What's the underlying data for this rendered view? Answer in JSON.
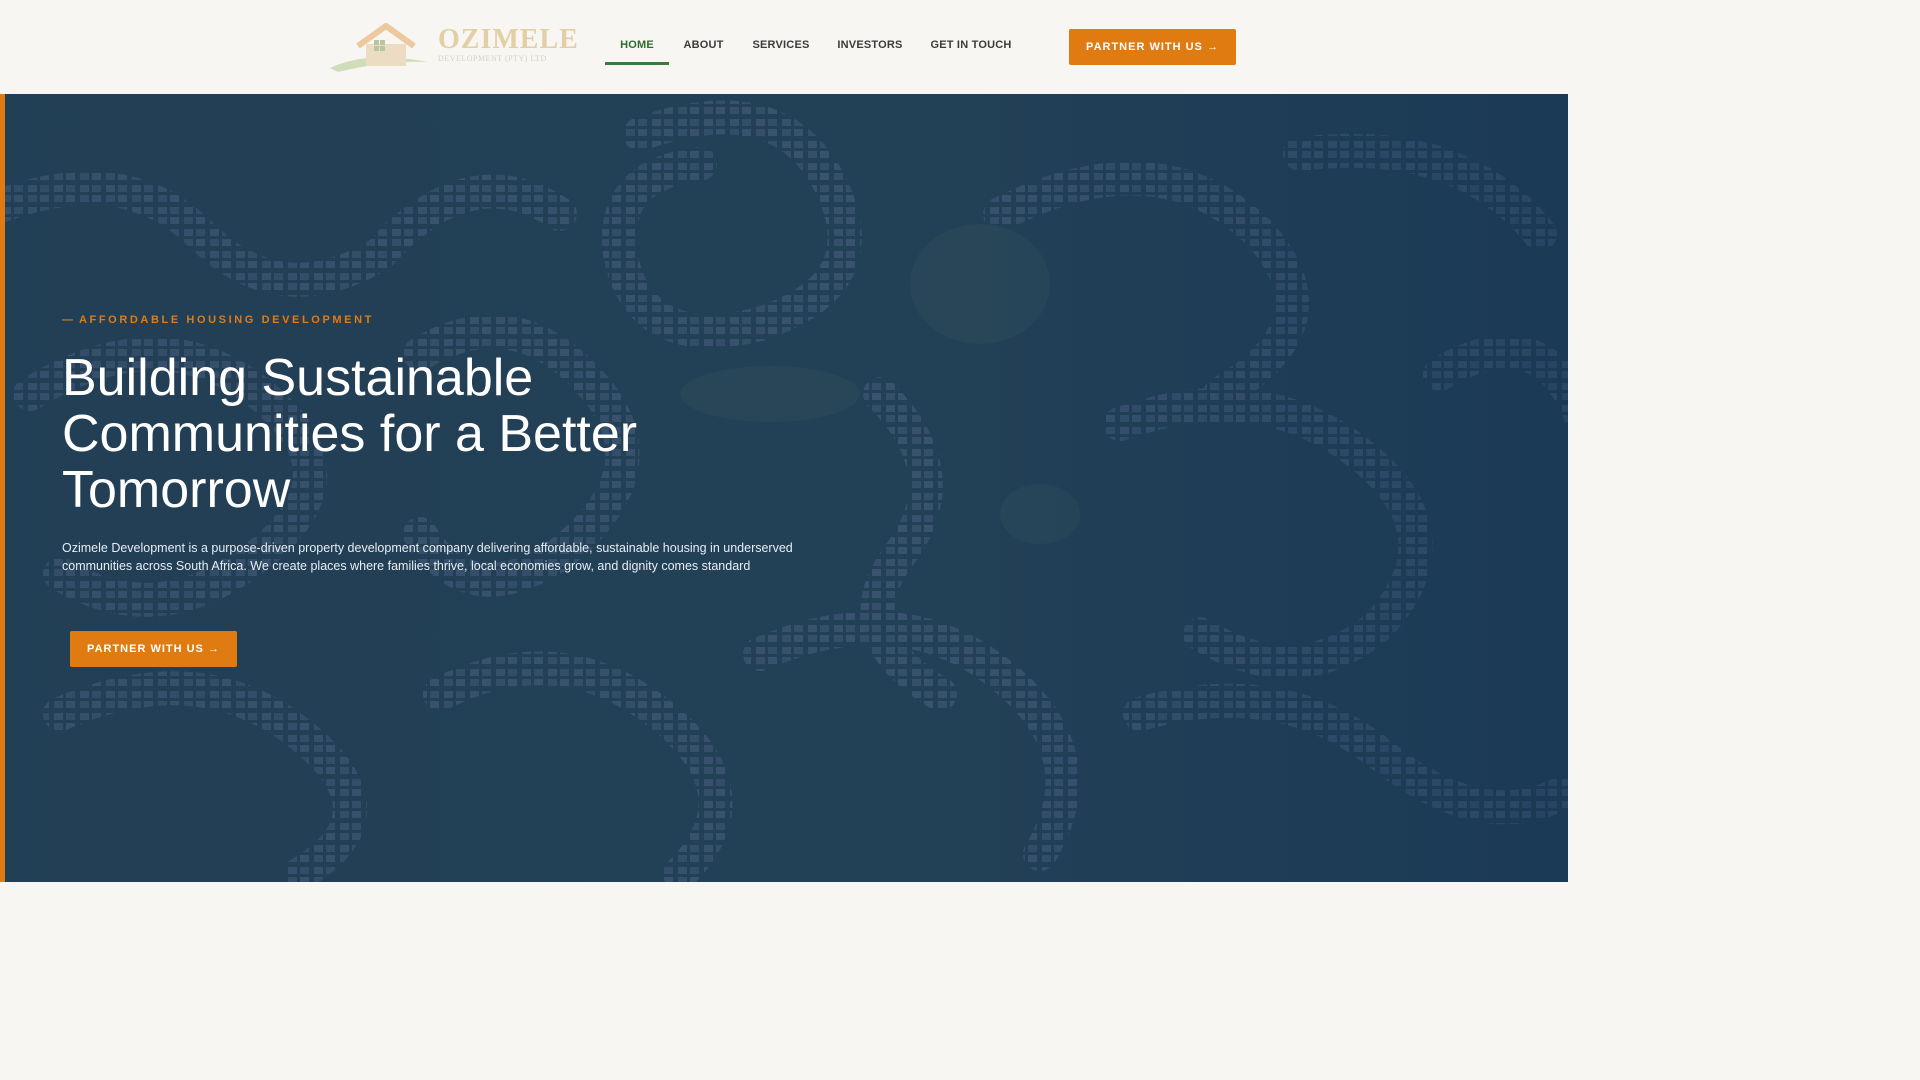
{
  "brand": {
    "name": "OZIMELE",
    "subtitle": "DEVELOPMENT (PTY) LTD",
    "logo_icon": "house-logo-icon"
  },
  "nav": {
    "items": [
      {
        "label": "HOME",
        "active": true
      },
      {
        "label": "ABOUT",
        "active": false
      },
      {
        "label": "SERVICES",
        "active": false
      },
      {
        "label": "INVESTORS",
        "active": false
      },
      {
        "label": "GET IN TOUCH",
        "active": false
      }
    ],
    "cta_label": "PARTNER WITH US →"
  },
  "hero": {
    "eyebrow_dash": "—",
    "eyebrow": "AFFORDABLE HOUSING DEVELOPMENT",
    "headline": "Building Sustainable Communities for a Better Tomorrow",
    "lead": "Ozimele Development is a purpose-driven property development company delivering affordable, sustainable housing in underserved communities across South Africa. We create places where families thrive, local economies grow, and dignity comes standard",
    "cta_label": "PARTNER WITH US →",
    "background": "aerial-housing-estate-image"
  },
  "colors": {
    "accent": "#e07b12",
    "nav_active": "#3b7a3b",
    "hero_overlay": "#1d3e61",
    "header_bg": "#f8f6f2"
  }
}
